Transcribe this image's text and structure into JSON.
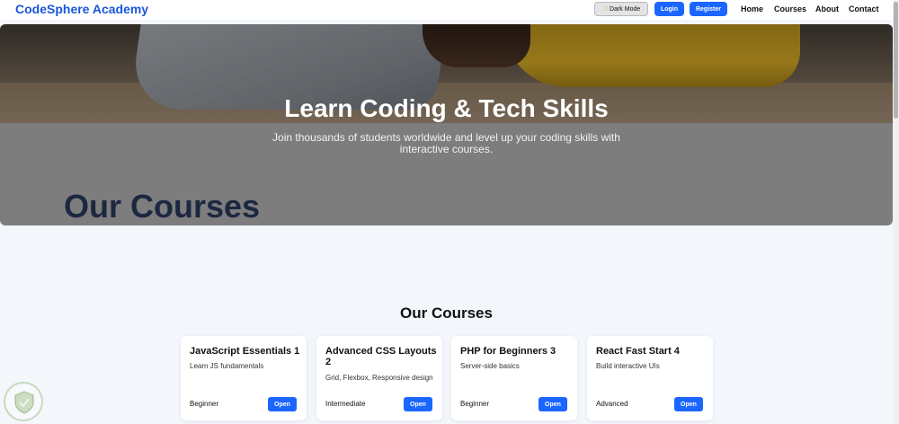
{
  "nav": {
    "brand": "CodeSphere Academy",
    "dark_mode_label": "Dark Mode",
    "moon_icon": "moon-icon",
    "login_label": "Login",
    "register_label": "Register",
    "links": [
      "Home",
      "Courses",
      "About",
      "Contact"
    ]
  },
  "hero": {
    "title": "Learn Coding & Tech Skills",
    "subtitle": "Join thousands of students worldwide and level up your coding skills with interactive courses.",
    "overlay_heading": "Our Courses"
  },
  "courses": {
    "title": "Our Courses",
    "open_label": "Open",
    "items": [
      {
        "title": "JavaScript Essentials 1",
        "desc": "Learn JS fundamentals",
        "level": "Beginner"
      },
      {
        "title": "Advanced CSS Layouts 2",
        "desc": "Grid, Flexbox, Responsive design",
        "level": "Intermediate"
      },
      {
        "title": "PHP for Beginners 3",
        "desc": "Server-side basics",
        "level": "Beginner"
      },
      {
        "title": "React Fast Start 4",
        "desc": "Build interactive UIs",
        "level": "Advanced"
      }
    ]
  },
  "colors": {
    "brand": "#1a56db",
    "button": "#1a66ff",
    "page_bg": "#f3f6fb",
    "hero_heading": "#1c2740"
  }
}
